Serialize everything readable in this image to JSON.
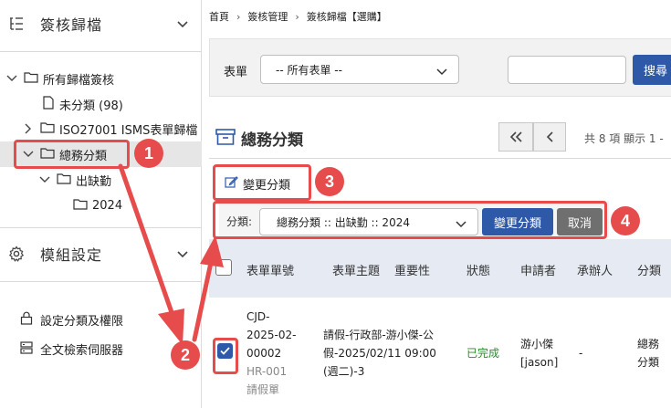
{
  "sidebar": {
    "section1_title": "簽核歸檔",
    "tree": {
      "root": "所有歸檔簽核",
      "uncategorized": "未分類 (98)",
      "iso": "ISO27001 ISMS表單歸檔",
      "general": "總務分類",
      "attendance": "出缺勤",
      "year": "2024"
    },
    "section2_title": "模組設定",
    "links": {
      "permissions": "設定分類及權限",
      "fulltext": "全文檢索伺服器"
    }
  },
  "breadcrumb": [
    "首頁",
    "簽核管理",
    "簽核歸檔【選購】"
  ],
  "filter": {
    "form_label": "表單",
    "form_select_value": "-- 所有表單 --",
    "search_value": "",
    "search_button": "搜尋"
  },
  "category": {
    "title": "總務分類"
  },
  "pager": {
    "info": "共 8 項 顯示 1 -"
  },
  "actions": {
    "change_category": "變更分類",
    "category_label": "分類:",
    "category_select_value": "總務分類 :: 出缺勤 :: 2024",
    "confirm_button": "變更分類",
    "cancel_button": "取消"
  },
  "table": {
    "headers": [
      "表單單號",
      "表單主題",
      "重要性",
      "狀態",
      "申請者",
      "承辦人",
      "分類"
    ],
    "row": {
      "number_lines": [
        "CJD-",
        "2025-02-",
        "00002"
      ],
      "form_code": "HR-001",
      "form_name": "請假單",
      "subject_lines": [
        "請假-行政部-游小傑-公",
        "假-2025/02/11 09:00",
        "(週二)-3"
      ],
      "importance": "",
      "status": "已完成",
      "applicant_lines": [
        "游小傑",
        "[jason]"
      ],
      "handler": "-",
      "category_lines": [
        "總務",
        "分類"
      ]
    }
  },
  "annotations": [
    "1",
    "2",
    "3",
    "4"
  ],
  "colors": {
    "accent": "#2e59a8",
    "annotation": "#e74c4c",
    "status_done": "#2e8b2e",
    "cancel": "#6f6f6f"
  }
}
